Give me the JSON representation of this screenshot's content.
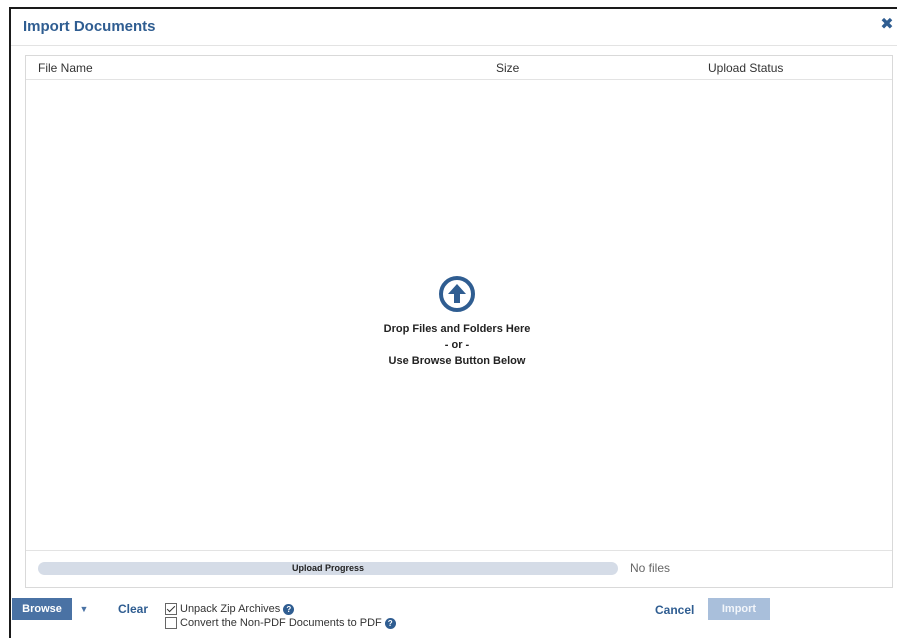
{
  "dialog": {
    "title": "Import Documents",
    "close_icon": "close-icon"
  },
  "table": {
    "columns": [
      "File Name",
      "Size",
      "Upload Status"
    ],
    "rows": []
  },
  "dropzone": {
    "icon": "upload-arrow-icon",
    "line1": "Drop Files and Folders Here",
    "line2": "- or -",
    "line3": "Use Browse Button Below"
  },
  "progress": {
    "label": "Upload Progress",
    "value": 0,
    "status": "No files"
  },
  "footer": {
    "browse_label": "Browse",
    "clear_label": "Clear",
    "options": [
      {
        "label": "Unpack Zip Archives",
        "checked": true
      },
      {
        "label": "Convert the Non-PDF Documents to PDF",
        "checked": false
      }
    ],
    "cancel_label": "Cancel",
    "import_label": "Import"
  },
  "colors": {
    "accent": "#2f5d91",
    "button": "#4a72a4",
    "button_disabled": "#a9bfdb",
    "progress_track": "#d5dce7"
  }
}
